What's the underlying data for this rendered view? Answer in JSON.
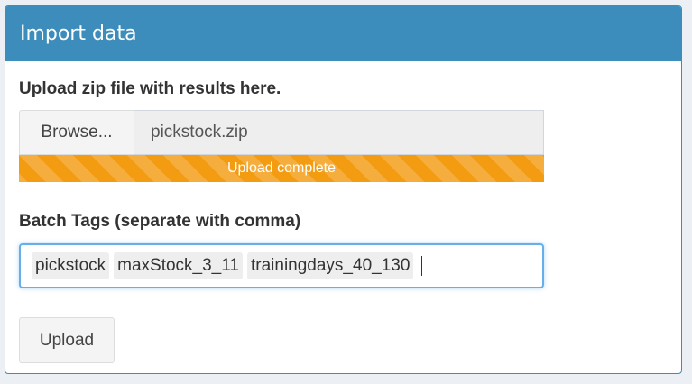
{
  "panel": {
    "title": "Import data"
  },
  "upload": {
    "label": "Upload zip file with results here.",
    "browse_label": "Browse...",
    "file_name": "pickstock.zip",
    "progress_text": "Upload complete",
    "progress_value": 1.0,
    "progress_color": "#f39c12"
  },
  "tags": {
    "label": "Batch Tags (separate with comma)",
    "items": [
      "pickstock",
      "maxStock_3_11",
      "trainingdays_40_130"
    ]
  },
  "actions": {
    "upload_label": "Upload"
  },
  "colors": {
    "header": "#3c8dbc",
    "focus_border": "#66afe9"
  }
}
